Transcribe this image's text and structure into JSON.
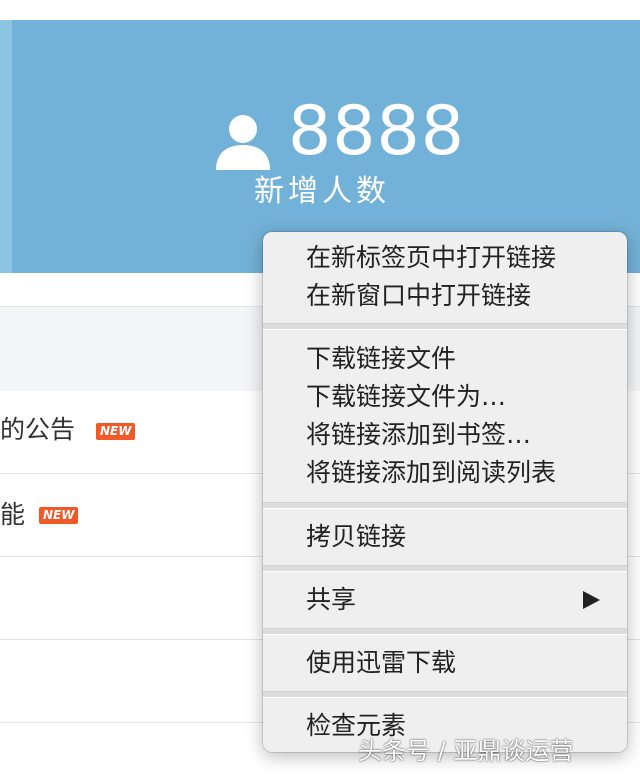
{
  "stats": {
    "value": "8888",
    "label": "新增人数",
    "icon": "user-icon"
  },
  "list": {
    "rows": [
      {
        "text": "的公告",
        "badge": "NEW"
      },
      {
        "text": "能",
        "badge": "NEW"
      }
    ]
  },
  "context_menu": {
    "groups": [
      [
        "在新标签页中打开链接",
        "在新窗口中打开链接"
      ],
      [
        "下载链接文件",
        "下载链接文件为…",
        "将链接添加到书签…",
        "将链接添加到阅读列表"
      ],
      [
        "拷贝链接"
      ],
      [
        "共享"
      ],
      [
        "使用迅雷下载"
      ],
      [
        "检查元素"
      ]
    ],
    "submenu_indicator": "triangle-right-icon"
  },
  "watermark": "头条号 / 亚鼎谈运营",
  "colors": {
    "banner": "#73b2d8",
    "badge": "#f05a28",
    "menu_bg": "#efefef"
  }
}
